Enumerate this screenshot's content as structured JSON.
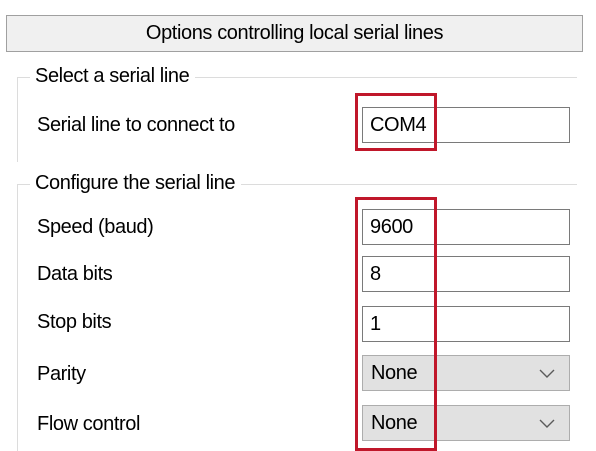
{
  "header": {
    "title": "Options controlling local serial lines"
  },
  "select_group": {
    "title": "Select a serial line",
    "serial_line_label": "Serial line to connect to",
    "serial_line_value": "COM4"
  },
  "config_group": {
    "title": "Configure the serial line",
    "speed_label": "Speed (baud)",
    "speed_value": "9600",
    "data_bits_label": "Data bits",
    "data_bits_value": "8",
    "stop_bits_label": "Stop bits",
    "stop_bits_value": "1",
    "parity_label": "Parity",
    "parity_value": "None",
    "flow_control_label": "Flow control",
    "flow_control_value": "None"
  },
  "icons": {
    "dropdown": "chevron-down-icon"
  },
  "colors": {
    "highlight": "#c0172a",
    "header_background": "#f0f0f0",
    "select_background": "#e1e1e1"
  }
}
